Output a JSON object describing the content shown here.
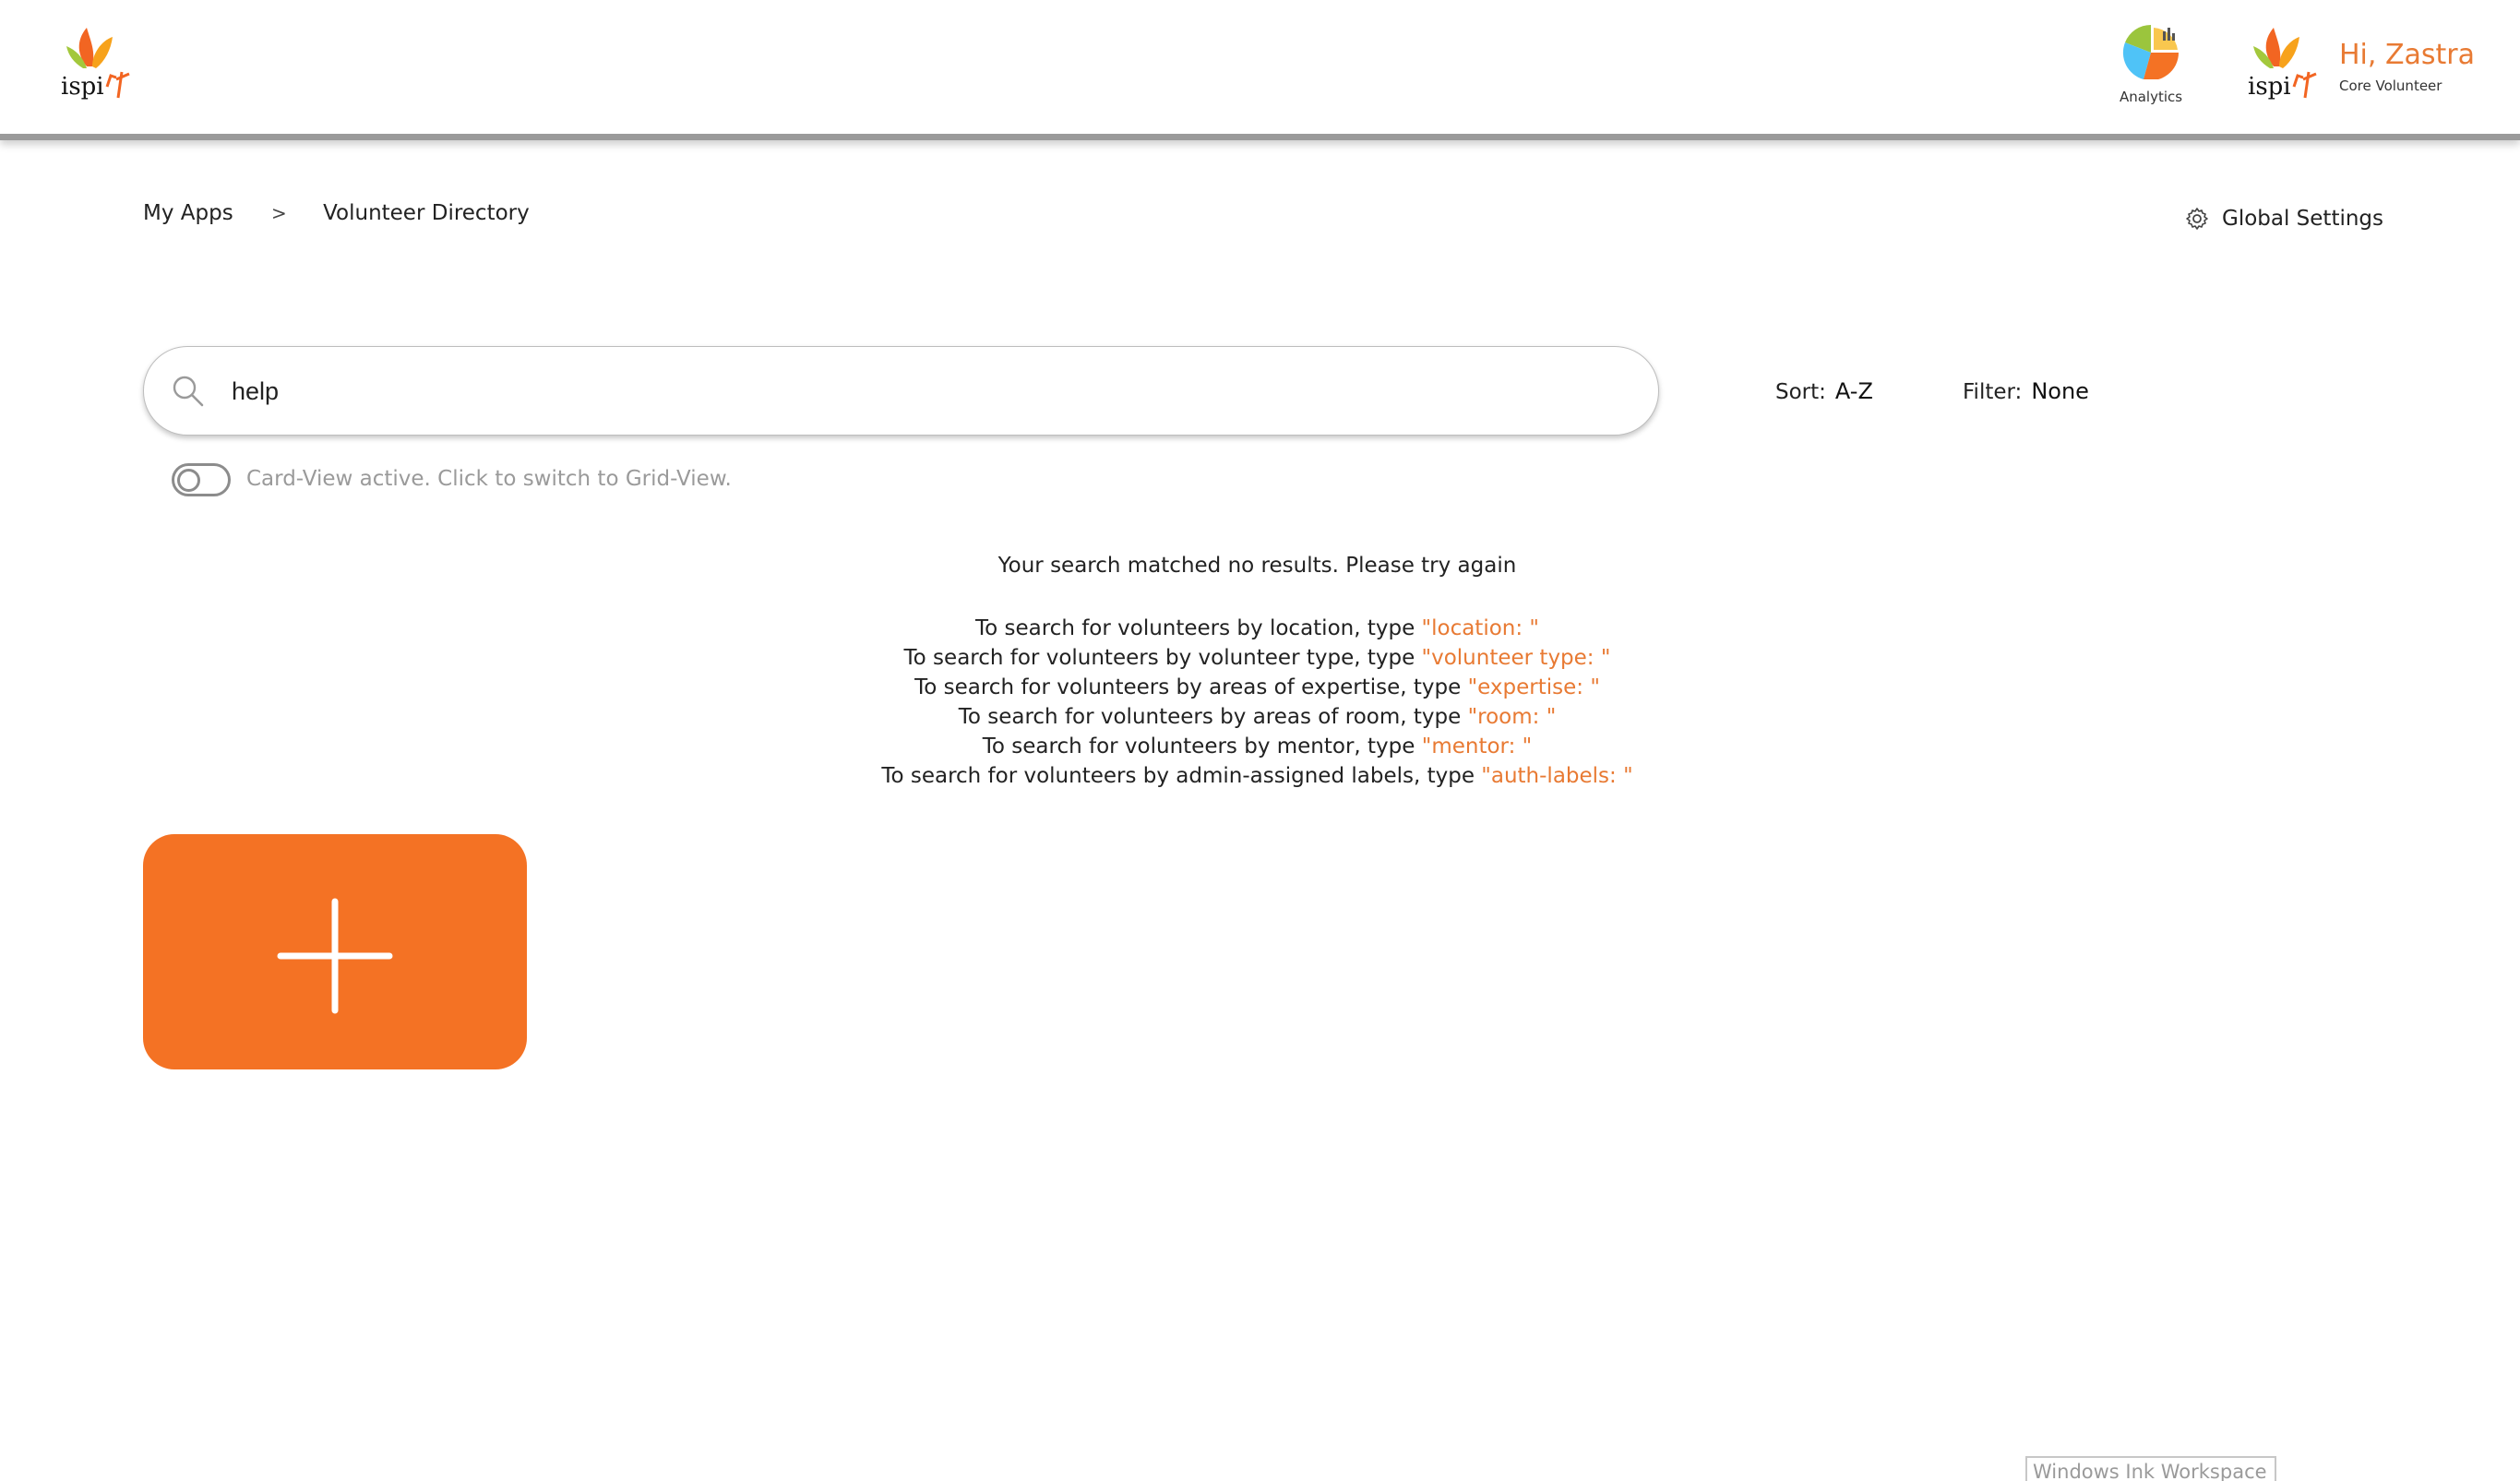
{
  "header": {
    "analytics_label": "Analytics",
    "greeting": "Hi, Zastra",
    "role": "Core Volunteer"
  },
  "breadcrumb": {
    "items": [
      "My Apps",
      "Volunteer Directory"
    ],
    "separator": ">"
  },
  "global_settings_label": "Global Settings",
  "search": {
    "value": "help"
  },
  "sort": {
    "label": "Sort:",
    "value": "A-Z"
  },
  "filter": {
    "label": "Filter:",
    "value": "None"
  },
  "view_toggle": {
    "on": false,
    "label": "Card-View active. Click to switch to Grid-View."
  },
  "no_results_message": "Your search matched no results. Please try again",
  "hints": [
    {
      "text": "To search for volunteers by location, type ",
      "keyword": "\"location: \""
    },
    {
      "text": "To search for volunteers by volunteer type, type ",
      "keyword": "\"volunteer type: \""
    },
    {
      "text": "To search for volunteers by areas of expertise, type ",
      "keyword": "\"expertise: \""
    },
    {
      "text": "To search for volunteers by areas of room, type ",
      "keyword": "\"room: \""
    },
    {
      "text": "To search for volunteers by mentor, type ",
      "keyword": "\"mentor: \""
    },
    {
      "text": "To search for volunteers by admin-assigned labels, type ",
      "keyword": "\"auth-labels: \""
    }
  ],
  "taskbar": {
    "ink_workspace_label": "Windows Ink Workspace"
  },
  "colors": {
    "accent": "#e87a33",
    "add_card": "#f47224",
    "header_border": "#9a9a9a",
    "muted_text": "#9a9a9a"
  },
  "icons": {
    "logo": "ispirt-logo",
    "analytics": "pie-chart-icon",
    "settings": "gear-icon",
    "search": "search-icon",
    "add": "plus-icon"
  }
}
